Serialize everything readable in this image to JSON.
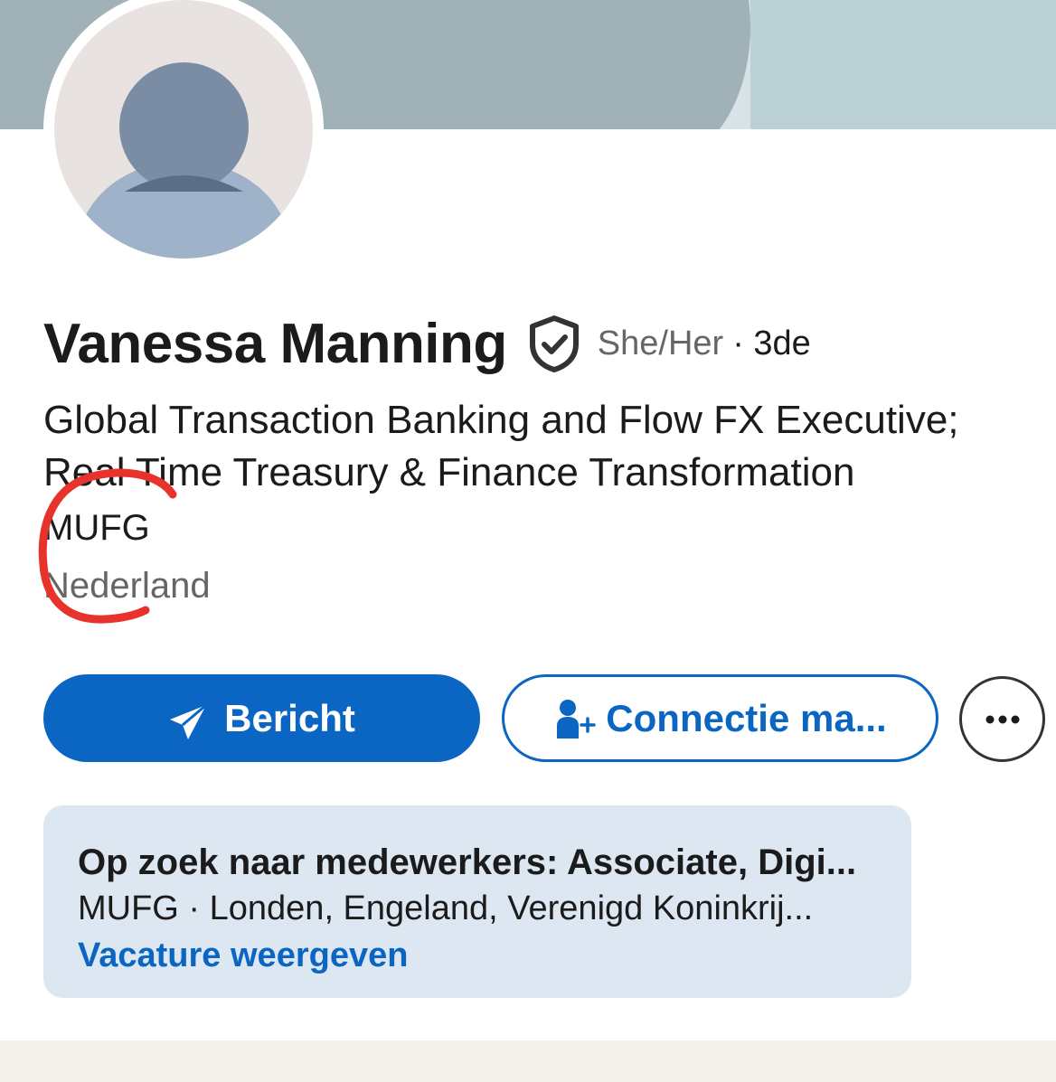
{
  "profile": {
    "name": "Vanessa Manning",
    "pronouns": "She/Her",
    "degree": "· 3de",
    "headline_line1": "Global Transaction Banking and Flow FX Executive;",
    "headline_line2": "Real Time Treasury & Finance Transformation",
    "company": "MUFG",
    "location": "Nederland",
    "verified_icon": "verified-shield-icon",
    "avatar_icon": "default-person-avatar"
  },
  "actions": {
    "message_label": "Bericht",
    "message_icon": "send-icon",
    "connect_label": "Connectie ma...",
    "connect_icon": "add-person-icon",
    "more_icon": "more-dots-icon"
  },
  "hiring": {
    "title": "Op zoek naar medewerkers: Associate, Digi...",
    "subtitle": "MUFG · Londen, Engeland, Verenigd Koninkrij...",
    "link_label": "Vacature weergeven"
  },
  "colors": {
    "accent": "#0a66c2",
    "annotation": "#e8332d",
    "card_bg": "#dde7f1"
  }
}
